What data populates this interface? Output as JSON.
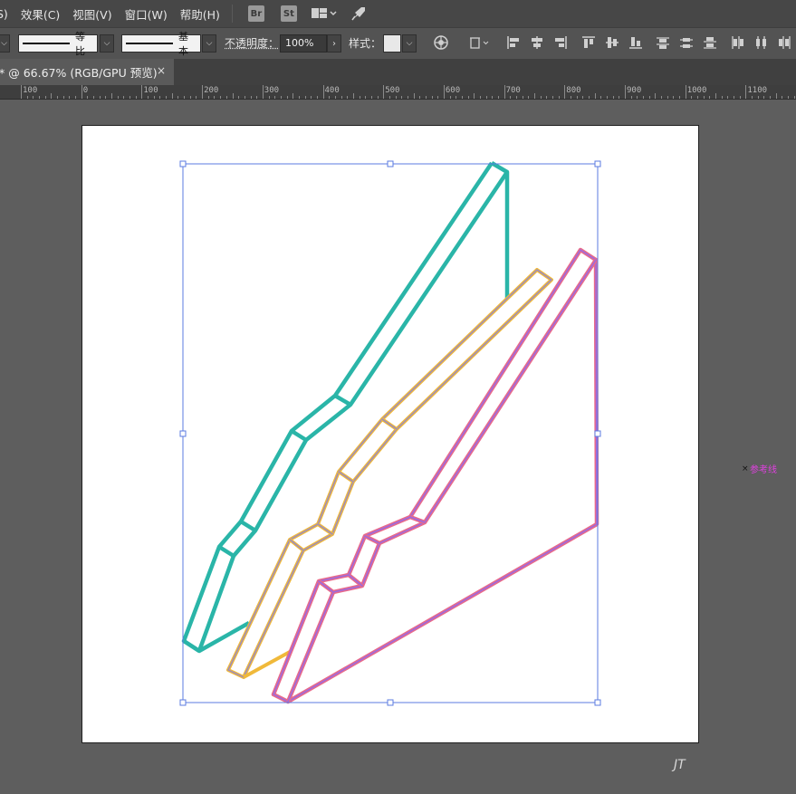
{
  "menubar": {
    "items": [
      "S)",
      "效果(C)",
      "视图(V)",
      "窗口(W)",
      "帮助(H)"
    ],
    "app_icons": [
      {
        "label": "Br",
        "name": "bridge-icon"
      },
      {
        "label": "St",
        "name": "stock-icon"
      }
    ]
  },
  "control_bar": {
    "stroke_profile_label": "等比",
    "brush_label": "基本",
    "opacity_label": "不透明度：",
    "opacity_value": "100%",
    "style_label": "样式："
  },
  "document_tab": {
    "title": "* @ 66.67% (RGB/GPU 预览)",
    "close": "×"
  },
  "ruler": {
    "labels": [
      "100",
      "0",
      "100",
      "200",
      "300",
      "400",
      "500",
      "600",
      "700",
      "800",
      "900",
      "1000",
      "1100"
    ]
  },
  "canvas": {
    "guide_label": "参考线",
    "guide_marker": "×",
    "watermark": "JT"
  },
  "colors": {
    "teal": "#2ab5a8",
    "gold": "#f0b93a",
    "gray_purple": "#9b8cc0",
    "pink": "#e86a8a",
    "violet": "#9a6ae0",
    "selection": "#5b7be0"
  }
}
